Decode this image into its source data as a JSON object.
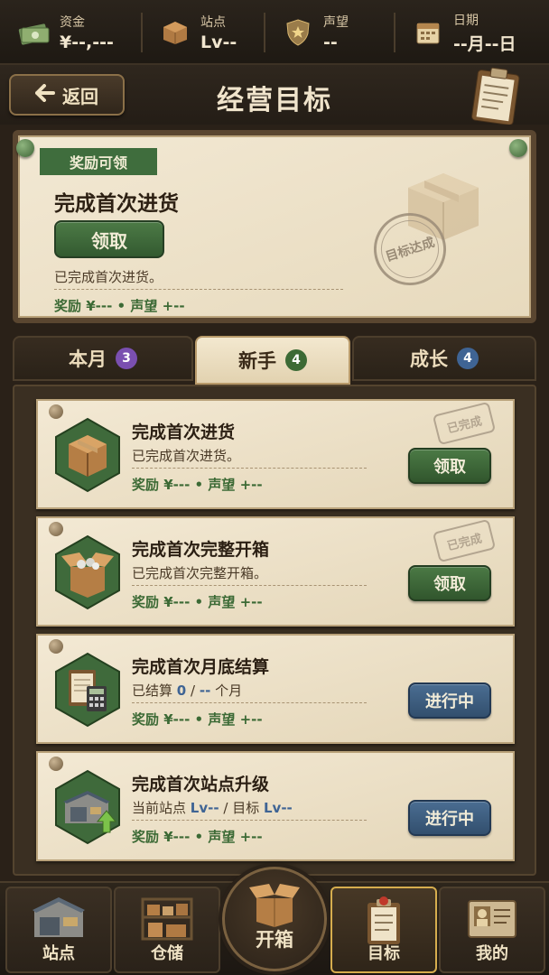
{
  "stats": [
    {
      "label": "资金",
      "value": "¥--,---",
      "icon": "money-icon"
    },
    {
      "label": "站点",
      "value": "Lv--",
      "icon": "box-icon"
    },
    {
      "label": "声望",
      "value": "--",
      "icon": "shield-star-icon"
    },
    {
      "label": "日期",
      "value": "--月--日",
      "icon": "calendar-icon"
    }
  ],
  "header": {
    "back_label": "返回",
    "title": "经营目标"
  },
  "featured": {
    "ribbon": "奖励可领",
    "title": "完成首次进货",
    "claim_label": "领取",
    "desc": "已完成首次进货。",
    "reward": "奖励 ¥--- • 声望 +--",
    "stamp": "目标达成"
  },
  "tabs": [
    {
      "label": "本月",
      "count": "3",
      "badge_color": "#7a4fb0"
    },
    {
      "label": "新手",
      "count": "4",
      "badge_color": "#3c6a35"
    },
    {
      "label": "成长",
      "count": "4",
      "badge_color": "#3f6494"
    }
  ],
  "tasks": [
    {
      "title": "完成首次进货",
      "desc": "已完成首次进货。",
      "reward": "奖励 ¥--- • 声望 +--",
      "action": "领取",
      "done_stamp": "已完成",
      "icon": "cardboard-box-icon"
    },
    {
      "title": "完成首次完整开箱",
      "desc": "已完成首次完整开箱。",
      "reward": "奖励 ¥--- • 声望 +--",
      "action": "领取",
      "done_stamp": "已完成",
      "icon": "open-box-icon"
    },
    {
      "title": "完成首次月底结算",
      "desc_prefix": "已结算",
      "desc_current": "0",
      "desc_sep": "/",
      "desc_total": "--",
      "desc_suffix": "个月",
      "reward": "奖励 ¥--- • 声望 +--",
      "action": "进行中",
      "icon": "clipboard-calculator-icon"
    },
    {
      "title": "完成首次站点升级",
      "desc_prefix": "当前站点",
      "desc_current": "Lv--",
      "desc_sep": "/ 目标",
      "desc_total": "Lv--",
      "reward": "奖励 ¥--- • 声望 +--",
      "action": "进行中",
      "icon": "station-upgrade-icon"
    }
  ],
  "nav": [
    {
      "label": "站点",
      "icon": "station-icon"
    },
    {
      "label": "仓储",
      "icon": "warehouse-shelf-icon"
    },
    {
      "label": "开箱",
      "icon": "open-box-icon"
    },
    {
      "label": "目标",
      "icon": "clipboard-goal-icon"
    },
    {
      "label": "我的",
      "icon": "profile-card-icon"
    }
  ],
  "colors": {
    "accent_green": "#3c6a35",
    "accent_blue": "#3f6494",
    "nav_active_border": "#d6ad4e"
  }
}
